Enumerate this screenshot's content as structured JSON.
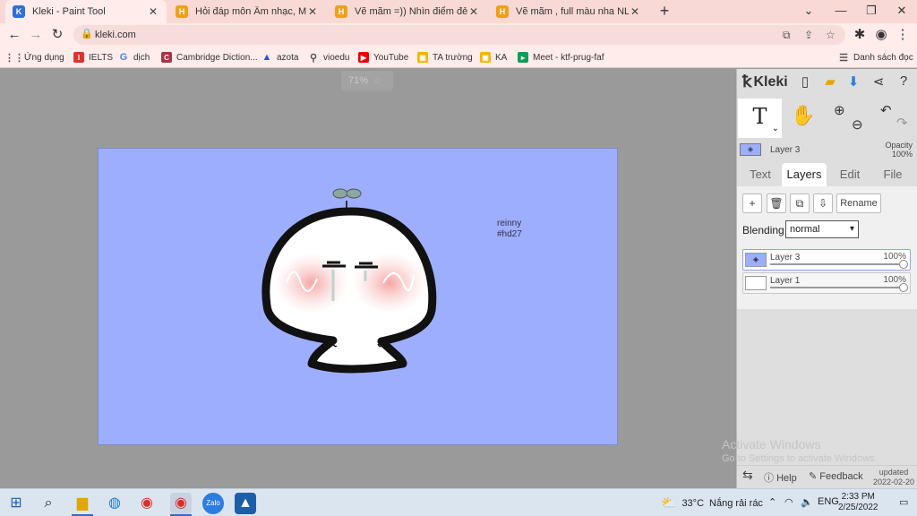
{
  "browser": {
    "tabs": [
      {
        "title": "Kleki - Paint Tool",
        "icon": "kleki-favicon",
        "active": true
      },
      {
        "title": "Hỏi đáp môn Âm nhạc, Mỹ thuật",
        "icon": "hoidap-favicon",
        "active": false
      },
      {
        "title": "Vẽ mãm =)) Nhìn điểm đẻ :) cầu",
        "icon": "hoidap-favicon",
        "active": false
      },
      {
        "title": "Vẽ mãm , full màu nha NL; Ác qu",
        "icon": "hoidap-favicon",
        "active": false
      }
    ],
    "url": "kleki.com",
    "bookmarks": [
      {
        "label": "Ứng dụng",
        "icon": "apps-grid-icon"
      },
      {
        "label": "IELTS",
        "icon": "ielts-icon"
      },
      {
        "label": "dịch",
        "icon": "google-icon"
      },
      {
        "label": "Cambridge Diction...",
        "icon": "cambridge-icon"
      },
      {
        "label": "azota",
        "icon": "azota-icon"
      },
      {
        "label": "vioedu",
        "icon": "vioedu-icon"
      },
      {
        "label": "YouTube",
        "icon": "youtube-icon"
      },
      {
        "label": "TA trường",
        "icon": "classroom-icon"
      },
      {
        "label": "KA",
        "icon": "classroom-icon"
      },
      {
        "label": "Meet - ktf-prug-faf",
        "icon": "meet-icon"
      }
    ],
    "reading_list": "Danh sách đọc"
  },
  "kleki": {
    "logo": "Kleki",
    "zoom": "71%",
    "canvas_text": {
      "line1": "reinny",
      "line2": "#hd27"
    },
    "active_layer": {
      "name": "Layer 3",
      "opacity_label": "Opacity",
      "opacity": "100%"
    },
    "tabs": [
      "Text",
      "Layers",
      "Edit",
      "File"
    ],
    "active_tab": "Layers",
    "layer_buttons": [
      "+",
      "🗑",
      "⧉",
      "⇩"
    ],
    "rename_label": "Rename",
    "blending_label": "Blending",
    "blending_value": "normal",
    "layers": [
      {
        "name": "Layer 3",
        "opacity": "100%",
        "selected": true
      },
      {
        "name": "Layer 1",
        "opacity": "100%",
        "selected": false
      }
    ],
    "help_label": "Help",
    "feedback_label": "Feedback",
    "updated_label": "updated",
    "updated_date": "2022-02-20"
  },
  "watermark": {
    "title": "Activate Windows",
    "subtitle": "Go to Settings to activate Windows."
  },
  "taskbar": {
    "weather_temp": "33°C",
    "weather_desc": "Nắng rải rác",
    "language": "ENG",
    "time": "2:33 PM",
    "date": "2/25/2022"
  },
  "colors": {
    "canvas_bg": "#9eaeff",
    "tab_strip": "#f9d9d6",
    "panel_bg": "#dedede"
  }
}
